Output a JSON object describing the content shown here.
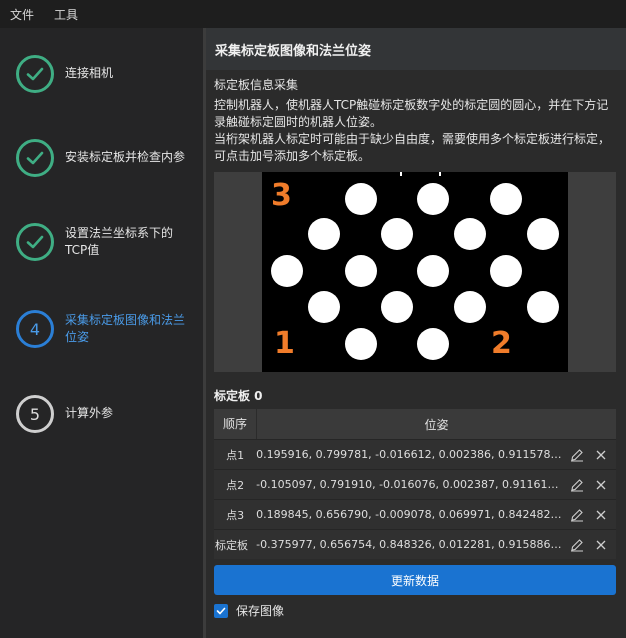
{
  "menubar": {
    "items": [
      "文件",
      "工具"
    ]
  },
  "sidebar": {
    "steps": [
      {
        "label": "连接相机",
        "state": "done"
      },
      {
        "label": "安装标定板并检查内参",
        "state": "done"
      },
      {
        "label": "设置法兰坐标系下的TCP值",
        "state": "done"
      },
      {
        "label": "采集标定板图像和法兰位姿",
        "state": "active",
        "number": "4"
      },
      {
        "label": "计算外参",
        "state": "pending",
        "number": "5"
      }
    ]
  },
  "main": {
    "title": "采集标定板图像和法兰位姿",
    "section_title": "标定板信息采集",
    "description_1": "控制机器人，使机器人TCP触碰标定板数字处的标定圆的圆心，并在下方记录触碰标定圆时的机器人位姿。",
    "description_2": "当桁架机器人标定时可能由于缺少自由度，需要使用多个标定板进行标定，可点击加号添加多个标定板。",
    "image": {
      "markers": [
        "3",
        "1",
        "2"
      ],
      "marker_color": "#f07c2a"
    },
    "board_label": "标定板 0",
    "table": {
      "headers": {
        "order": "顺序",
        "pose": "位姿"
      },
      "rows": [
        {
          "order": "点1",
          "pose": "0.195916, 0.799781, -0.016612, 0.002386, 0.911578, -0.41111..."
        },
        {
          "order": "点2",
          "pose": "-0.105097, 0.791910, -0.016076, 0.002387, 0.911614, -0.4110..."
        },
        {
          "order": "点3",
          "pose": "0.189845, 0.656790, -0.009078, 0.069971, 0.842482, -0.53290..."
        },
        {
          "order": "标定板",
          "pose": "-0.375977, 0.656754, 0.848326, 0.012281, 0.915886, -0.40118..."
        }
      ]
    },
    "update_button": "更新数据",
    "save_images": {
      "label": "保存图像",
      "checked": true
    }
  },
  "colors": {
    "accent": "#1a73d1",
    "done": "#3fae84",
    "active": "#2b7fd6"
  }
}
